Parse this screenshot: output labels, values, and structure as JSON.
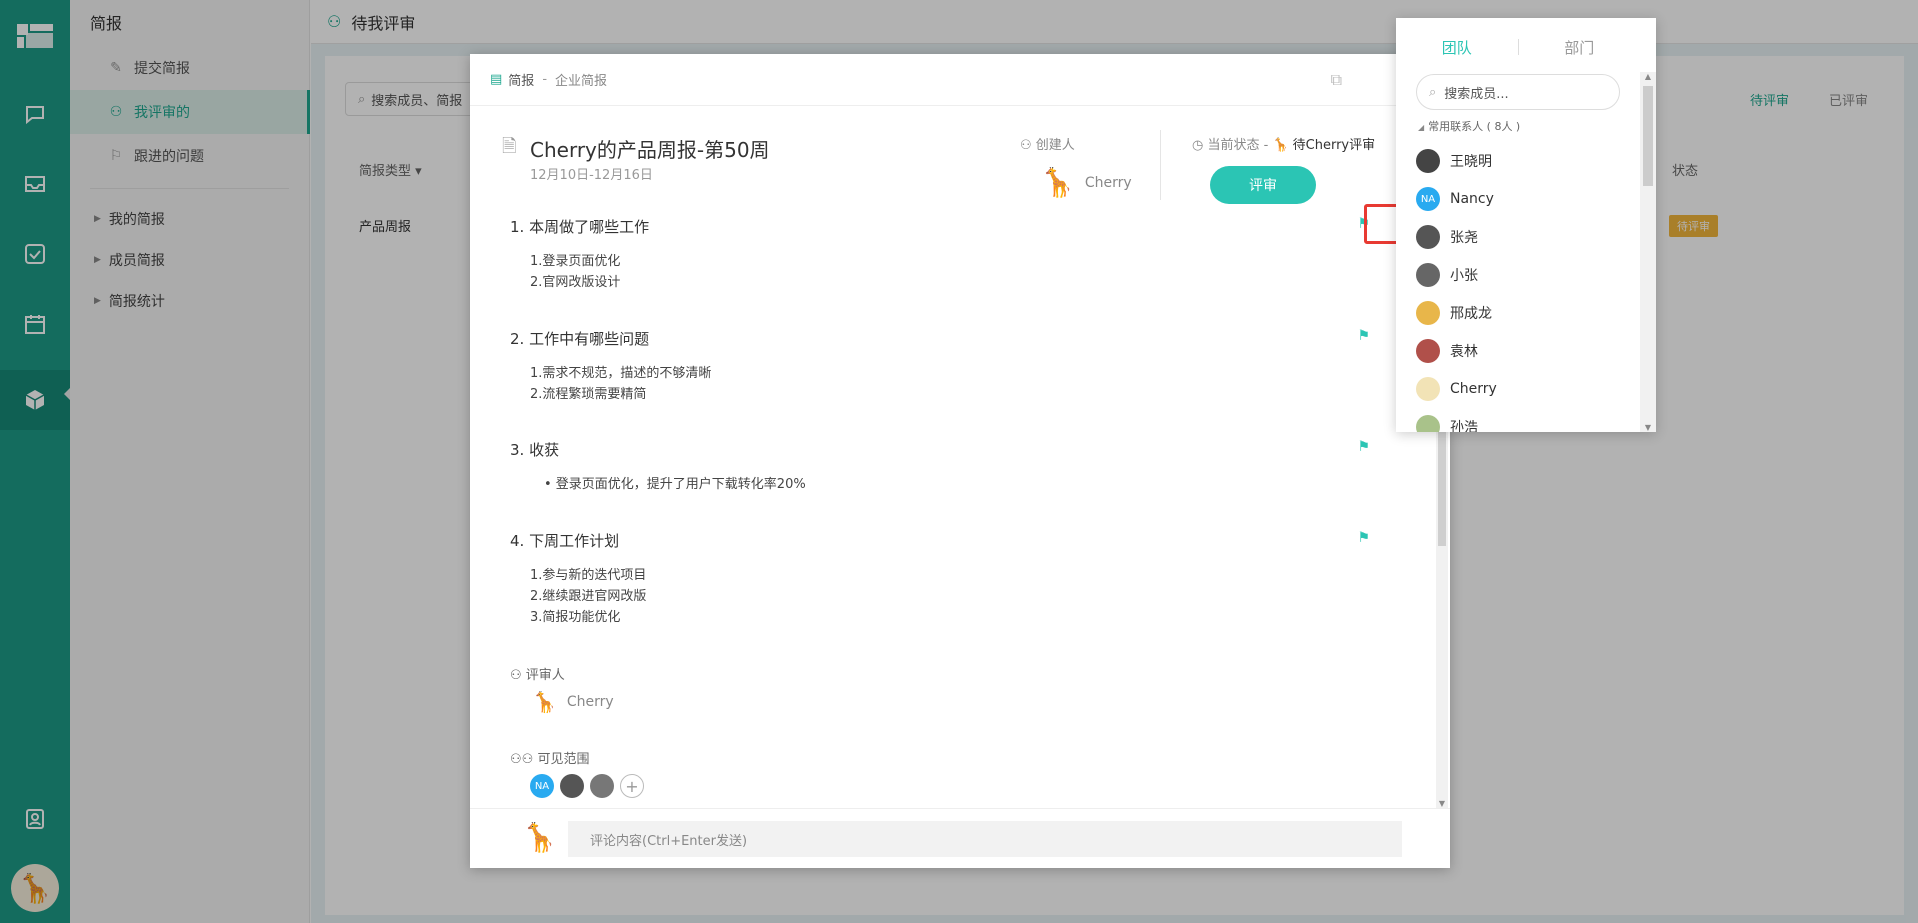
{
  "rail": {
    "icons": [
      "logo-icon",
      "chat-icon",
      "inbox-icon",
      "check-icon",
      "calendar-icon",
      "cube-icon",
      "contacts-icon"
    ],
    "brand_color": "#1d9b87"
  },
  "sidebar": {
    "title": "简报",
    "items": [
      {
        "label": "提交简报",
        "icon": "edit-doc-icon"
      },
      {
        "label": "我评审的",
        "icon": "user-check-icon"
      },
      {
        "label": "跟进的问题",
        "icon": "flag-icon"
      }
    ],
    "groups": [
      {
        "label": "我的简报"
      },
      {
        "label": "成员简报"
      },
      {
        "label": "简报统计"
      }
    ]
  },
  "page": {
    "title": "待我评审",
    "search_placeholder": "搜索成员、简报",
    "tabs": [
      "待评审",
      "已评审"
    ],
    "col_type": "简报类型 ▾",
    "col_state": "状态",
    "row_type": "产品周报",
    "row_badge": "待评审"
  },
  "modal": {
    "breadcrumb_root": "简报",
    "breadcrumb_sep": "-",
    "breadcrumb_sub": "企业简报",
    "title": "Cherry的产品周报-第50周",
    "date_range": "12月10日-12月16日",
    "creator_label": "创建人",
    "creator_name": "Cherry",
    "state_label": "当前状态 -",
    "state_value": "待Cherry评审",
    "review_button": "评审",
    "sections": [
      {
        "heading": "1. 本周做了哪些工作",
        "lines": [
          "1.登录页面优化",
          "2.官网改版设计"
        ]
      },
      {
        "heading": "2. 工作中有哪些问题",
        "lines": [
          "1.需求不规范，描述的不够清晰",
          "2.流程繁琐需要精简"
        ]
      },
      {
        "heading": "3. 收获",
        "lines": [
          "•  登录页面优化，提升了用户下载转化率20%"
        ]
      },
      {
        "heading": "4. 下周工作计划",
        "lines": [
          "1.参与新的迭代项目",
          "2.继续跟进官网改版",
          "3.简报功能优化"
        ]
      }
    ],
    "reviewer_label": "评审人",
    "reviewer_name": "Cherry",
    "visible_label": "可见范围",
    "visible_avatars": [
      "NA",
      "",
      "",
      "+"
    ],
    "comment_placeholder": "评论内容(Ctrl+Enter发送)"
  },
  "picker": {
    "tabs": [
      "团队",
      "部门"
    ],
    "search_placeholder": "搜索成员...",
    "group_label": "常用联系人 ( 8人 )",
    "members": [
      {
        "name": "王晓明",
        "avatar": "",
        "color": "#444"
      },
      {
        "name": "Nancy",
        "avatar": "NA",
        "color": "#29aaf0"
      },
      {
        "name": "张尧",
        "avatar": "",
        "color": "#555"
      },
      {
        "name": "小张",
        "avatar": "",
        "color": "#666"
      },
      {
        "name": "邢成龙",
        "avatar": "",
        "color": "#e8b64a"
      },
      {
        "name": "袁林",
        "avatar": "",
        "color": "#b0504a"
      },
      {
        "name": "Cherry",
        "avatar": "",
        "color": "#f2e3b6"
      },
      {
        "name": "孙浩",
        "avatar": "",
        "color": "#a9c28a"
      }
    ]
  }
}
